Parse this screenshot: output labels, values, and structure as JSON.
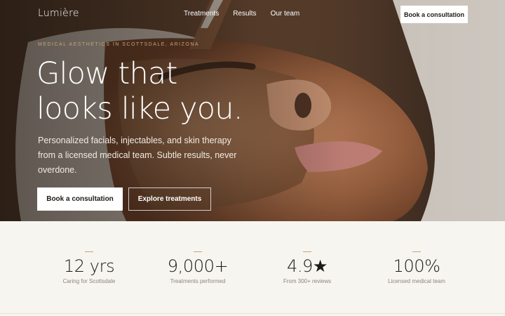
{
  "brand": {
    "logo": "Lumière"
  },
  "nav": {
    "links": [
      "Treatments",
      "Results",
      "Our team"
    ],
    "cta": "Book a consultation"
  },
  "hero": {
    "eyebrow": "MEDICAL AESTHETICS IN SCOTTSDALE, ARIZONA",
    "headline_line1": "Glow that",
    "headline_line2": "looks like you.",
    "subtext": "Personalized facials, injectables, and skin therapy from a licensed medical team. Subtle results, never overdone.",
    "primary_button": "Book a consultation",
    "secondary_button": "Explore treatments",
    "image": "facial-treatment-photo"
  },
  "stats": [
    {
      "value": "12 yrs",
      "label": "Caring for Scottsdale"
    },
    {
      "value": "9,000+",
      "label": "Treatments performed"
    },
    {
      "value": "4.9★",
      "label": "From 300+ reviews"
    },
    {
      "value": "100%",
      "label": "Licensed medical team"
    }
  ],
  "colors": {
    "accent": "#c6a277",
    "text_dark": "#1c1a17",
    "muted": "#8a847c",
    "background": "#f7f5f0"
  }
}
